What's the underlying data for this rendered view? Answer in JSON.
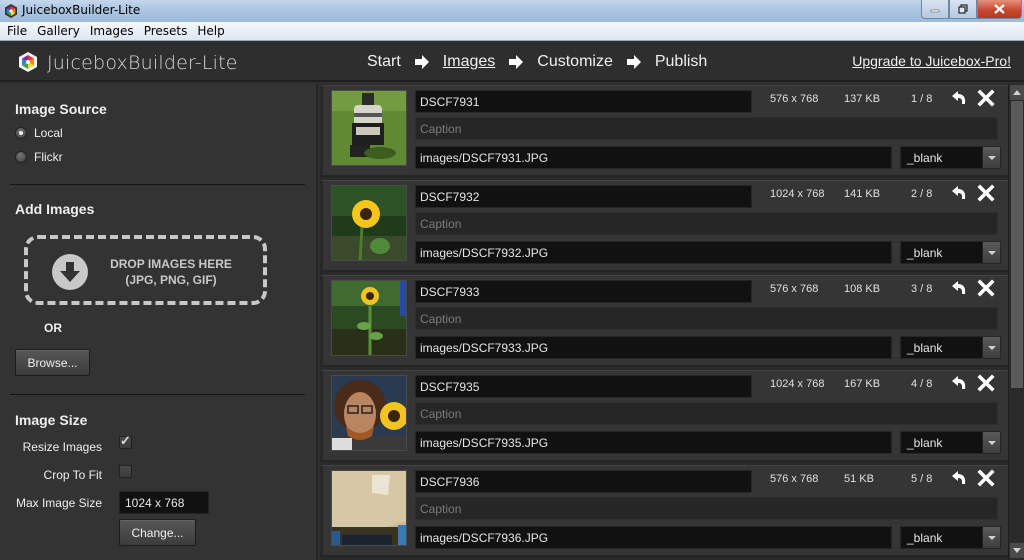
{
  "window": {
    "title": "JuiceboxBuilder-Lite",
    "controls": [
      "minimize",
      "restore",
      "close"
    ]
  },
  "menubar": {
    "items": [
      "File",
      "Gallery",
      "Images",
      "Presets",
      "Help"
    ]
  },
  "header": {
    "brand": "JuiceboxBuilder-Lite",
    "steps": [
      {
        "label": "Start",
        "active": false
      },
      {
        "label": "Images",
        "active": true
      },
      {
        "label": "Customize",
        "active": false
      },
      {
        "label": "Publish",
        "active": false
      }
    ],
    "upgrade_link": "Upgrade to Juicebox-Pro!"
  },
  "left_panel": {
    "image_source": {
      "title": "Image Source",
      "options": [
        {
          "label": "Local",
          "checked": true
        },
        {
          "label": "Flickr",
          "checked": false
        }
      ]
    },
    "add_images": {
      "title": "Add Images",
      "dropzone_line1": "DROP IMAGES HERE",
      "dropzone_line2": "(JPG, PNG, GIF)",
      "or_label": "OR",
      "browse_button": "Browse..."
    },
    "image_size": {
      "title": "Image Size",
      "resize_label": "Resize Images",
      "resize_checked": true,
      "crop_label": "Crop To Fit",
      "crop_checked": false,
      "max_size_label": "Max Image Size",
      "max_size_value": "1024 x 768",
      "change_button": "Change..."
    }
  },
  "images": [
    {
      "title": "DSCF7931",
      "caption_placeholder": "Caption",
      "link": "images/DSCF7931.JPG",
      "dimensions": "576 x 768",
      "size": "137 KB",
      "index": "1 / 8",
      "target": "_blank",
      "thumb": "stove"
    },
    {
      "title": "DSCF7932",
      "caption_placeholder": "Caption",
      "link": "images/DSCF7932.JPG",
      "dimensions": "1024 x 768",
      "size": "141 KB",
      "index": "2 / 8",
      "target": "_blank",
      "thumb": "sunflower"
    },
    {
      "title": "DSCF7933",
      "caption_placeholder": "Caption",
      "link": "images/DSCF7933.JPG",
      "dimensions": "576 x 768",
      "size": "108 KB",
      "index": "3 / 8",
      "target": "_blank",
      "thumb": "sunflower-tall"
    },
    {
      "title": "DSCF7935",
      "caption_placeholder": "Caption",
      "link": "images/DSCF7935.JPG",
      "dimensions": "1024 x 768",
      "size": "167 KB",
      "index": "4 / 8",
      "target": "_blank",
      "thumb": "portrait"
    },
    {
      "title": "DSCF7936",
      "caption_placeholder": "Caption",
      "link": "images/DSCF7936.JPG",
      "dimensions": "576 x 768",
      "size": "51 KB",
      "index": "5 / 8",
      "target": "_blank",
      "thumb": "ceiling"
    }
  ],
  "icons": {
    "row_actions": [
      "undo-icon",
      "close-icon"
    ],
    "dropzone": "download-arrow-icon",
    "step_separator": "arrow-right-icon"
  }
}
